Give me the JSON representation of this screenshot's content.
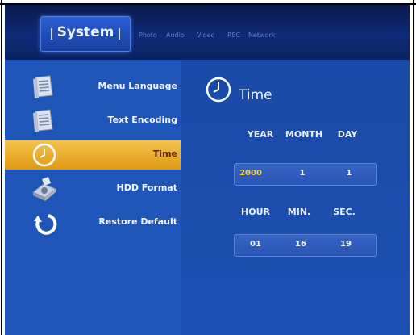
{
  "header": {
    "active_tab": "System",
    "tabs": [
      "Photo",
      "Audio",
      "Video",
      "REC",
      "Network"
    ]
  },
  "menu": {
    "items": [
      {
        "label": "Menu Language",
        "icon": "document-icon",
        "selected": false
      },
      {
        "label": "Text Encoding",
        "icon": "document-icon",
        "selected": false
      },
      {
        "label": "Time",
        "icon": "clock-icon",
        "selected": true
      },
      {
        "label": "HDD Format",
        "icon": "hdd-icon",
        "selected": false
      },
      {
        "label": "Restore Default",
        "icon": "restore-icon",
        "selected": false
      }
    ]
  },
  "panel": {
    "title": "Time",
    "date_headers": [
      "YEAR",
      "MONTH",
      "DAY"
    ],
    "date_values": [
      "2000",
      "1",
      "1"
    ],
    "time_headers": [
      "HOUR",
      "MIN.",
      "SEC."
    ],
    "time_values": [
      "01",
      "16",
      "19"
    ]
  },
  "colors": {
    "menu_bg": "#1f55b8",
    "selection": "#f0b531",
    "highlight_value": "#f7d04a"
  }
}
